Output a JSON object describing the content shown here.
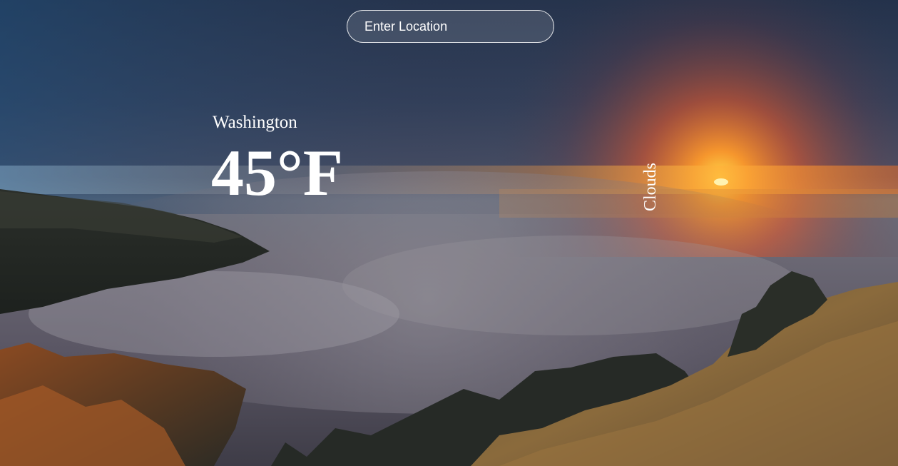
{
  "search": {
    "placeholder": "Enter Location",
    "value": ""
  },
  "weather": {
    "location": "Washington",
    "temperature": "45°F",
    "condition": "Clouds"
  }
}
